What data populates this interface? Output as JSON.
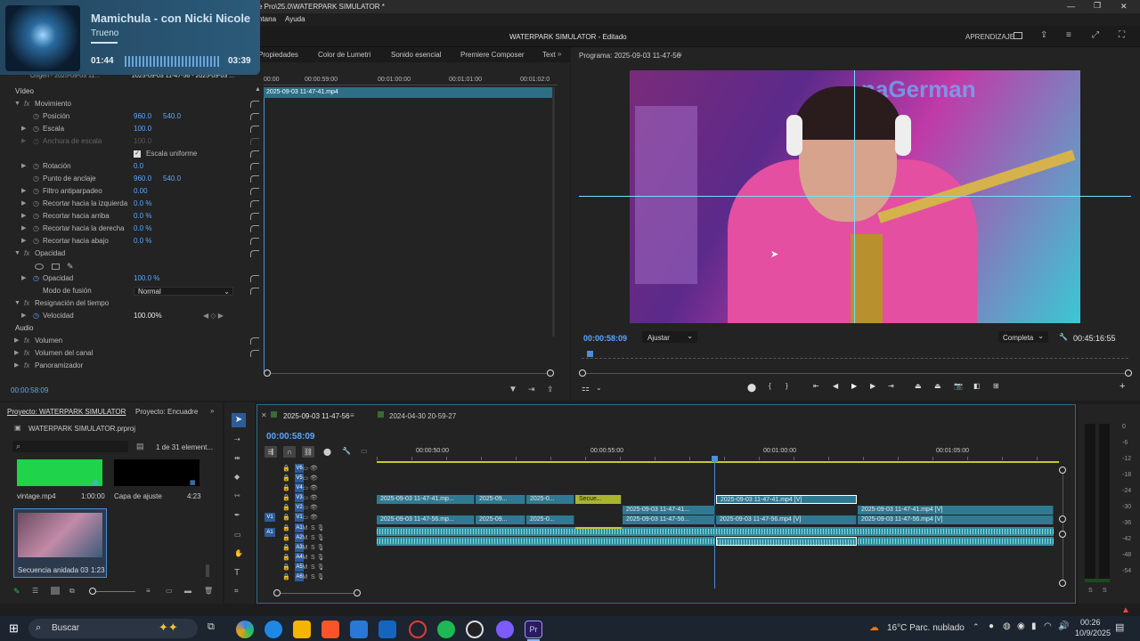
{
  "window": {
    "title_partial": "e Pro\\25.0\\WATERPARK SIMULATOR *",
    "title_prefix": "2...",
    "minimize": "—",
    "restore": "❐",
    "close": "✕"
  },
  "menu": {
    "items": [
      "ntana",
      "Ayuda"
    ]
  },
  "workspace": {
    "tabs": [
      "Propiedades",
      "Color de Lumetri",
      "Sonido esencial",
      "Premiere Composer",
      "Text"
    ],
    "center_title": "WATERPARK SIMULATOR - Editado",
    "aprendizaje": "APRENDIZAJE"
  },
  "media_overlay": {
    "song": "Mamichula - con Nicki Nicole",
    "artist": "Trueno",
    "elapsed": "01:44",
    "total": "03:39"
  },
  "effect_controls": {
    "source_label": "Origen - 2025-09-03 11...",
    "seq_label": "2025-09-03 11-47-56 - 2025-09-03 ...",
    "clip_name": "2025-09-03 11-47-41.mp4",
    "ruler": [
      "00:00",
      "00:00:59:00",
      "00:01:00:00",
      "00:01:01:00",
      "00:01:02:0"
    ],
    "video_header": "Vídeo",
    "rows": [
      {
        "label": "Movimiento",
        "level": 0,
        "fx": true
      },
      {
        "label": "Posición",
        "level": 1,
        "v1": "960.0",
        "v2": "540.0"
      },
      {
        "label": "Escala",
        "level": 1,
        "v1": "100.0"
      },
      {
        "label": "Anchura de escala",
        "level": 1,
        "v1": "100.0",
        "disabled": true
      },
      {
        "label": "Escala uniforme",
        "level": 2,
        "checkbox": true
      },
      {
        "label": "Rotación",
        "level": 1,
        "v1": "0.0"
      },
      {
        "label": "Punto de anclaje",
        "level": 1,
        "v1": "960.0",
        "v2": "540.0"
      },
      {
        "label": "Filtro antiparpadeo",
        "level": 1,
        "v1": "0.00"
      },
      {
        "label": "Recortar hacia la izquierda",
        "level": 1,
        "v1": "0.0 %"
      },
      {
        "label": "Recortar hacia arriba",
        "level": 1,
        "v1": "0.0 %"
      },
      {
        "label": "Recortar hacia la derecha",
        "level": 1,
        "v1": "0.0 %"
      },
      {
        "label": "Recortar hacia abajo",
        "level": 1,
        "v1": "0.0 %"
      },
      {
        "label": "Opacidad",
        "level": 0,
        "fx": true
      },
      {
        "label": "",
        "level": 1,
        "masks": true
      },
      {
        "label": "Opacidad",
        "level": 1,
        "v1": "100.0 %"
      },
      {
        "label": "Modo de fusión",
        "level": 1,
        "select": "Normal"
      },
      {
        "label": "Resignación del tiempo",
        "level": 0,
        "fx": true
      },
      {
        "label": "Velocidad",
        "level": 1,
        "v1": "100.00%",
        "plain": true
      }
    ],
    "audio_header": "Audio",
    "audio_rows": [
      "Volumen",
      "Volumen del canal",
      "Panoramizador"
    ],
    "timecode": "00:00:58:09"
  },
  "program": {
    "title": "Programa: 2025-09-03 11-47-56",
    "timecode": "00:00:58:09",
    "fit": "Ajustar",
    "quality": "Completa",
    "duration": "00:45:16:55",
    "watermark_text": "naGerman"
  },
  "project": {
    "tab1": "Proyecto: WATERPARK SIMULATOR",
    "tab2": "Proyecto: Encuadre",
    "file": "WATERPARK SIMULATOR.prproj",
    "count": "1 de 31 element...",
    "items": [
      {
        "name": "vintage.mp4",
        "duration": "1:00:00",
        "color": "#1fd34a"
      },
      {
        "name": "Capa de ajuste",
        "duration": "4:23",
        "color": "#000000"
      },
      {
        "name": "Secuencia anidada 03",
        "duration": "1:23",
        "color": "#6b4b5f"
      }
    ]
  },
  "timeline": {
    "tab1": "2025-09-03 11-47-56",
    "tab2": "2024-04-30 20-59-27",
    "timecode": "00:00:58:09",
    "ruler": [
      "00:00:50:00",
      "00:00:55:00",
      "00:01:00:00",
      "00:01:05:00"
    ],
    "video_tracks": [
      "V6",
      "V5",
      "V4",
      "V3",
      "V2",
      "V1"
    ],
    "audio_tracks": [
      "A1",
      "A2",
      "A3",
      "A4",
      "A5",
      "A6"
    ],
    "clips_v3": [
      "2025-09-03 11-47-41.mp...",
      "2025-09...",
      "2025-0...",
      "Secue...",
      "2025-09-03 11-47-41.mp4 [V]"
    ],
    "clips_v2": [
      "2025-09-03 11-47-41...",
      "2025-09-03 11-47-41.mp4 [V]"
    ],
    "clips_v1": [
      "2025-09-03 11-47-56.mp...",
      "2025-09...",
      "2025-0...",
      "2025-09-03 11-47-56...",
      "2025-09-03 11-47-56.mp4 [V]",
      "2025-09-03 11-47-56.mp4 [V]"
    ],
    "meter_scale": [
      "0",
      "-6",
      "-12",
      "-18",
      "-24",
      "-30",
      "-36",
      "-42",
      "-48",
      "-54"
    ],
    "meter_s": [
      "S",
      "S"
    ]
  },
  "taskbar": {
    "search": "Buscar",
    "weather": "16°C  Parc. nublado",
    "time": "00:26",
    "date": "10/9/2025"
  }
}
